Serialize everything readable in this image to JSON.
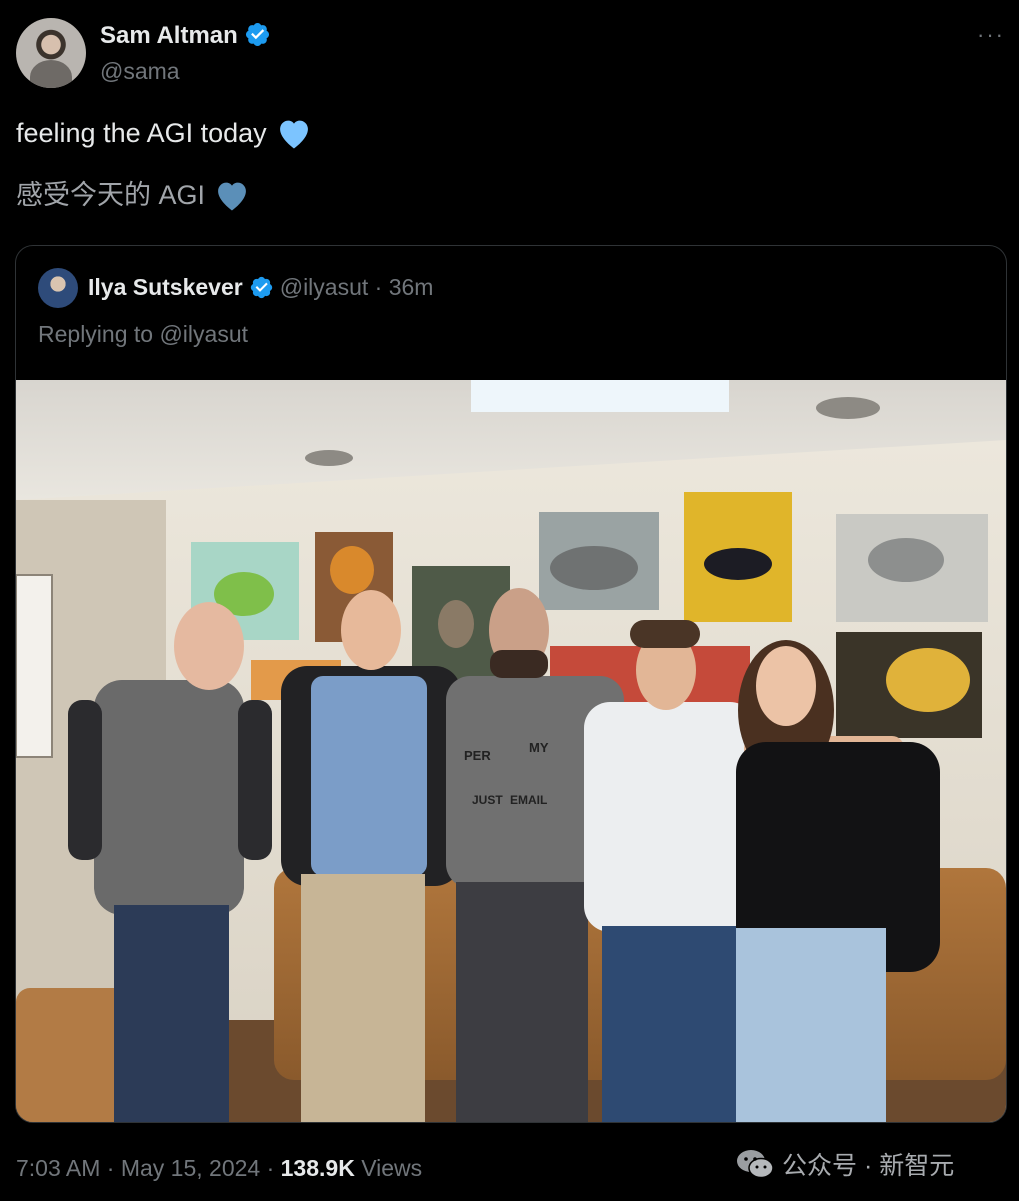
{
  "tweet": {
    "author_name": "Sam Altman",
    "author_handle": "@sama",
    "more_glyph": "···",
    "text_line1": "feeling the AGI today",
    "text_line2": "感受今天的 AGI",
    "timestamp": "7:03 AM · May 15, 2024 ·",
    "views_count": "138.9K",
    "views_label": "Views",
    "heart_color_primary": "#7cc4ff",
    "heart_color_secondary": "#5b8fb8"
  },
  "quoted": {
    "author_name": "Ilya Sutskever",
    "author_handle": "@ilyasut · 36m",
    "replying_to": "Replying to @ilyasut",
    "photo_shirt_text": [
      "PER",
      "MY",
      "JUST",
      "EMAIL"
    ]
  },
  "watermark": {
    "text": "公众号 · 新智元"
  },
  "colors": {
    "background": "#000000",
    "text_primary": "#e7e9ea",
    "text_secondary": "#71767b",
    "verified_blue": "#1d9bf0",
    "border": "#2f3336"
  }
}
